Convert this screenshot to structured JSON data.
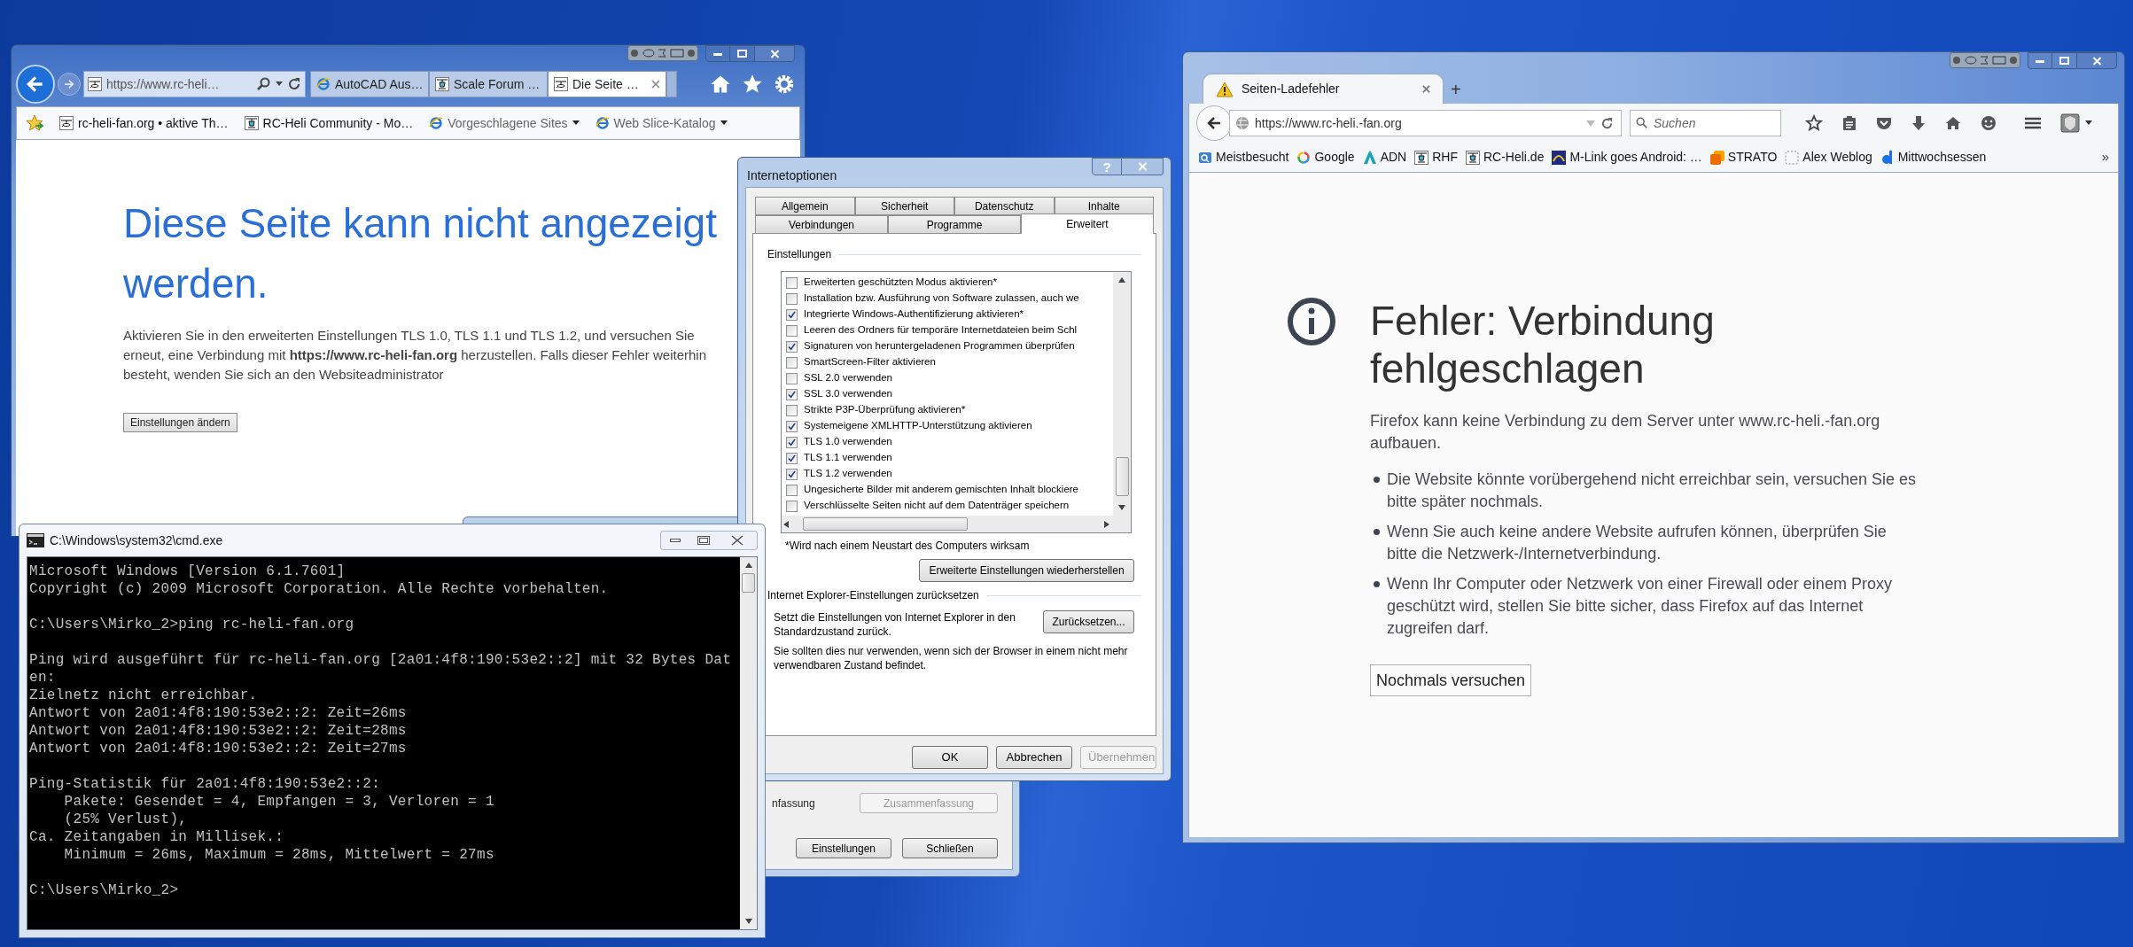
{
  "ie": {
    "address": "https://www.rc-heli…",
    "tabs": [
      {
        "label": "AutoCAD Aus…",
        "kind": "swirl",
        "selected": false
      },
      {
        "label": "Scale Forum …",
        "kind": "heli",
        "selected": false
      },
      {
        "label": "Die Seite …",
        "kind": "page",
        "selected": true
      }
    ],
    "favorites": [
      {
        "label": "rc-heli-fan.org • aktive Th…",
        "kind": "page",
        "dropdown": false
      },
      {
        "label": "RC-Heli Community - Mo…",
        "kind": "heli",
        "dropdown": false
      },
      {
        "label": "Vorgeschlagene Sites",
        "kind": "swirl",
        "dropdown": true
      },
      {
        "label": "Web Slice-Katalog",
        "kind": "swirl",
        "dropdown": true
      }
    ],
    "heading": "Diese Seite kann nicht angezeigt werden.",
    "message": "Aktivieren Sie in den erweiterten Einstellungen TLS 1.0, TLS 1.1 und TLS 1.2, und versuchen Sie erneut, eine Verbindung mit **https://www.rc-heli-fan.org** herzustellen. Falls dieser Fehler weiterhin besteht, wenden Sie sich an den Websiteadministrator",
    "button": "Einstellungen ändern"
  },
  "background_window": {
    "label": "nfassung",
    "buttons": [
      {
        "label": "Zusammenfassung",
        "disabled": true
      },
      {
        "label": "Einstellungen",
        "disabled": false
      },
      {
        "label": "Schließen",
        "disabled": false
      }
    ]
  },
  "options": {
    "title": "Internetoptionen",
    "help": "?",
    "tab_rows": [
      [
        {
          "label": "Allgemein",
          "selected": false
        },
        {
          "label": "Sicherheit",
          "selected": false
        },
        {
          "label": "Datenschutz",
          "selected": false
        },
        {
          "label": "Inhalte",
          "selected": false
        }
      ],
      [
        {
          "label": "Verbindungen",
          "selected": false
        },
        {
          "label": "Programme",
          "selected": false
        },
        {
          "label": "Erweitert",
          "selected": true
        }
      ]
    ],
    "group": "Einstellungen",
    "settings": [
      {
        "label": "Erweiterten geschützten Modus aktivieren*",
        "checked": false
      },
      {
        "label": "Installation bzw. Ausführung von Software zulassen, auch we",
        "checked": false
      },
      {
        "label": "Integrierte Windows-Authentifizierung aktivieren*",
        "checked": true
      },
      {
        "label": "Leeren des Ordners für temporäre Internetdateien beim Schl",
        "checked": false
      },
      {
        "label": "Signaturen von heruntergeladenen Programmen überprüfen",
        "checked": true
      },
      {
        "label": "SmartScreen-Filter aktivieren",
        "checked": false
      },
      {
        "label": "SSL 2.0 verwenden",
        "checked": false
      },
      {
        "label": "SSL 3.0 verwenden",
        "checked": true
      },
      {
        "label": "Strikte P3P-Überprüfung aktivieren*",
        "checked": false
      },
      {
        "label": "Systemeigene XMLHTTP-Unterstützung aktivieren",
        "checked": true
      },
      {
        "label": "TLS 1.0 verwenden",
        "checked": true
      },
      {
        "label": "TLS 1.1 verwenden",
        "checked": true
      },
      {
        "label": "TLS 1.2 verwenden",
        "checked": true
      },
      {
        "label": "Ungesicherte Bilder mit anderem gemischten Inhalt blockiere",
        "checked": false
      },
      {
        "label": "Verschlüsselte Seiten nicht auf dem Datenträger speichern",
        "checked": false
      }
    ],
    "note": "*Wird nach einem Neustart des Computers wirksam",
    "restore_button": "Erweiterte Einstellungen wiederherstellen",
    "reset_group": "Internet Explorer-Einstellungen zurücksetzen",
    "reset_text": "Setzt die Einstellungen von Internet Explorer in den Standardzustand zurück.",
    "reset_button": "Zurücksetzen...",
    "reset_warning": "Sie sollten dies nur verwenden, wenn sich der Browser in einem nicht mehr verwendbaren Zustand befindet.",
    "buttons": [
      {
        "label": "OK",
        "disabled": false
      },
      {
        "label": "Abbrechen",
        "disabled": false
      },
      {
        "label": "Übernehmen",
        "disabled": true
      }
    ]
  },
  "cmd": {
    "title": "C:\\Windows\\system32\\cmd.exe",
    "blocks": [
      [
        "Microsoft Windows [Version 6.1.7601]",
        "Copyright (c) 2009 Microsoft Corporation. Alle Rechte vorbehalten."
      ],
      [
        "C:\\Users\\Mirko_2>ping rc-heli-fan.org"
      ],
      [
        "Ping wird ausgeführt für rc-heli-fan.org [2a01:4f8:190:53e2::2] mit 32 Bytes Dat",
        "en:",
        "Zielnetz nicht erreichbar.",
        "Antwort von 2a01:4f8:190:53e2::2: Zeit=26ms",
        "Antwort von 2a01:4f8:190:53e2::2: Zeit=28ms",
        "Antwort von 2a01:4f8:190:53e2::2: Zeit=27ms"
      ],
      [
        "Ping-Statistik für 2a01:4f8:190:53e2::2:",
        "    Pakete: Gesendet = 4, Empfangen = 3, Verloren = 1",
        "    (25% Verlust),",
        "Ca. Zeitangaben in Millisek.:",
        "    Minimum = 26ms, Maximum = 28ms, Mittelwert = 27ms"
      ],
      [
        "C:\\Users\\Mirko_2>"
      ]
    ]
  },
  "firefox": {
    "tab": "Seiten-Ladefehler",
    "new_tab": "+",
    "url": "https://www.rc-heli.-fan.org",
    "search_placeholder": "Suchen",
    "bookmarks": [
      {
        "label": "Meistbesucht",
        "kind": "folder"
      },
      {
        "label": "Google",
        "kind": "ring"
      },
      {
        "label": "ADN",
        "kind": "triangle"
      },
      {
        "label": "RHF",
        "kind": "heli"
      },
      {
        "label": "RC-Heli.de",
        "kind": "heli"
      },
      {
        "label": "M-Link goes Android: …",
        "kind": "square"
      },
      {
        "label": "STRATO",
        "kind": "orange"
      },
      {
        "label": "Alex Weblog",
        "kind": "blank"
      },
      {
        "label": "Mittwochsessen",
        "kind": "drop"
      }
    ],
    "overflow": "»",
    "error": {
      "title": "Fehler: Verbindung fehlgeschlagen",
      "intro": "Firefox kann keine Verbindung zu dem Server unter www.rc-heli.-fan.org aufbauen.",
      "bullets": [
        "Die Website könnte vorübergehend nicht erreichbar sein, versuchen Sie es bitte später nochmals.",
        "Wenn Sie auch keine andere Website aufrufen können, überprüfen Sie bitte die Netzwerk-/Internetverbindung.",
        "Wenn Ihr Computer oder Netzwerk von einer Firewall oder einem Proxy geschützt wird, stellen Sie bitte sicher, dass Firefox auf das Internet zugreifen darf."
      ],
      "button": "Nochmals versuchen"
    }
  }
}
